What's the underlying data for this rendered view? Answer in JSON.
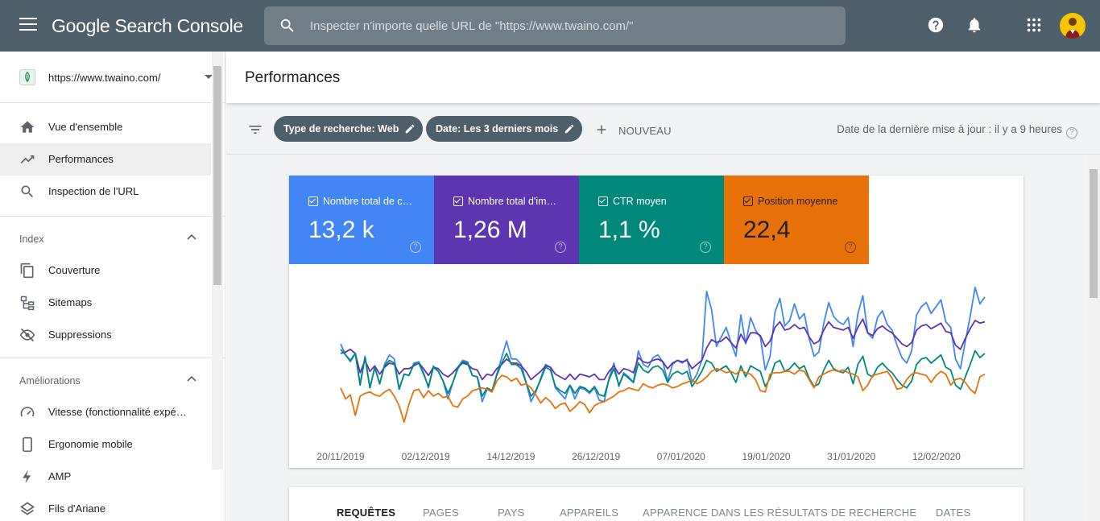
{
  "app": {
    "brand": "Google Search Console",
    "search_placeholder": "Inspecter n'importe quelle URL de \"https://www.twaino.com/\""
  },
  "sidebar": {
    "property_url": "https://www.twaino.com/",
    "top_items": [
      {
        "label": "Vue d'ensemble",
        "icon": "home-icon"
      },
      {
        "label": "Performances",
        "icon": "trending-up-icon",
        "active": true
      },
      {
        "label": "Inspection de l'URL",
        "icon": "search-icon"
      }
    ],
    "sections": [
      {
        "title": "Index",
        "items": [
          {
            "label": "Couverture",
            "icon": "copy-icon"
          },
          {
            "label": "Sitemaps",
            "icon": "sitemap-icon"
          },
          {
            "label": "Suppressions",
            "icon": "visibility-off-icon"
          }
        ]
      },
      {
        "title": "Améliorations",
        "items": [
          {
            "label": "Vitesse (fonctionnalité expé…",
            "icon": "speed-icon"
          },
          {
            "label": "Ergonomie mobile",
            "icon": "smartphone-icon"
          },
          {
            "label": "AMP",
            "icon": "bolt-icon"
          },
          {
            "label": "Fils d'Ariane",
            "icon": "layers-icon"
          }
        ]
      }
    ]
  },
  "main": {
    "page_title": "Performances",
    "filters": {
      "chips": [
        "Type de recherche: Web",
        "Date: Les 3 derniers mois"
      ],
      "new_label": "NOUVEAU",
      "updated": "Date de la dernière mise à jour : il y a 9 heures"
    },
    "metrics": [
      {
        "label": "Nombre total de c…",
        "value": "13,2 k",
        "color": "#4285f4",
        "text_color": "#ffffff"
      },
      {
        "label": "Nombre total d'im…",
        "value": "1,26 M",
        "color": "#5e35b1",
        "text_color": "#ffffff"
      },
      {
        "label": "CTR moyen",
        "value": "1,1 %",
        "color": "#00897b",
        "text_color": "#ffffff"
      },
      {
        "label": "Position moyenne",
        "value": "22,4",
        "color": "#e8710a",
        "text_color": "#202124"
      }
    ],
    "tabs": [
      "REQUÊTES",
      "PAGES",
      "PAYS",
      "APPAREILS",
      "APPARENCE DANS LES RÉSULTATS DE RECHERCHE",
      "DATES"
    ]
  },
  "chart_data": {
    "type": "line",
    "x_ticks": [
      "20/11/2019",
      "02/12/2019",
      "14/12/2019",
      "26/12/2019",
      "07/01/2020",
      "19/01/2020",
      "31/01/2020",
      "12/02/2020"
    ],
    "y_axis": "hidden (relative scale per series)",
    "grid": false,
    "series": [
      {
        "name": "Nombre total de c…",
        "color": "#4285f4",
        "values": [
          0.62,
          0.54,
          0.49,
          0.55,
          0.33,
          0.53,
          0.3,
          0.45,
          0.33,
          0.47,
          0.54,
          0.51,
          0.29,
          0.4,
          0.39,
          0.48,
          0.49,
          0.41,
          0.3,
          0.46,
          0.42,
          0.35,
          0.22,
          0.34,
          0.45,
          0.5,
          0.49,
          0.39,
          0.38,
          0.2,
          0.29,
          0.27,
          0.4,
          0.52,
          0.64,
          0.51,
          0.51,
          0.47,
          0.34,
          0.2,
          0.27,
          0.37,
          0.47,
          0.45,
          0.3,
          0.26,
          0.22,
          0.32,
          0.22,
          0.3,
          0.29,
          0.26,
          0.3,
          0.21,
          0.2,
          0.37,
          0.48,
          0.31,
          0.41,
          0.38,
          0.34,
          0.57,
          0.47,
          0.45,
          0.52,
          0.54,
          0.49,
          0.35,
          0.47,
          0.5,
          0.48,
          0.51,
          0.34,
          0.4,
          0.5,
          1.0,
          0.87,
          0.6,
          0.67,
          0.74,
          0.63,
          0.53,
          0.83,
          0.62,
          0.81,
          0.72,
          0.67,
          0.43,
          0.53,
          0.85,
          0.95,
          0.75,
          0.79,
          0.91,
          0.8,
          0.84,
          0.66,
          0.53,
          0.56,
          0.77,
          0.92,
          0.82,
          0.78,
          0.76,
          0.81,
          0.6,
          0.84,
          0.97,
          0.7,
          0.66,
          0.81,
          0.86,
          0.76,
          0.72,
          0.61,
          0.52,
          0.48,
          0.57,
          0.83,
          0.89,
          0.92,
          0.84,
          0.89,
          0.94,
          0.78,
          0.74,
          0.51,
          0.44,
          0.64,
          0.82,
          1.03,
          0.91,
          0.96
        ]
      },
      {
        "name": "Nombre total d'im…",
        "color": "#5e35b1",
        "values": [
          0.55,
          0.56,
          0.58,
          0.55,
          0.41,
          0.5,
          0.42,
          0.46,
          0.4,
          0.45,
          0.48,
          0.47,
          0.4,
          0.44,
          0.44,
          0.46,
          0.48,
          0.44,
          0.39,
          0.45,
          0.44,
          0.4,
          0.38,
          0.41,
          0.45,
          0.48,
          0.47,
          0.44,
          0.43,
          0.36,
          0.4,
          0.39,
          0.44,
          0.47,
          0.51,
          0.48,
          0.48,
          0.46,
          0.42,
          0.36,
          0.39,
          0.42,
          0.46,
          0.45,
          0.4,
          0.38,
          0.36,
          0.4,
          0.36,
          0.4,
          0.39,
          0.38,
          0.4,
          0.36,
          0.36,
          0.42,
          0.46,
          0.4,
          0.44,
          0.43,
          0.41,
          0.52,
          0.49,
          0.48,
          0.5,
          0.51,
          0.49,
          0.44,
          0.48,
          0.5,
          0.49,
          0.5,
          0.44,
          0.47,
          0.5,
          0.59,
          0.65,
          0.63,
          0.64,
          0.67,
          0.63,
          0.59,
          0.69,
          0.63,
          0.7,
          0.7,
          0.68,
          0.6,
          0.64,
          0.74,
          0.78,
          0.72,
          0.73,
          0.76,
          0.73,
          0.74,
          0.67,
          0.62,
          0.64,
          0.72,
          0.78,
          0.74,
          0.73,
          0.72,
          0.74,
          0.66,
          0.74,
          0.8,
          0.7,
          0.68,
          0.73,
          0.75,
          0.72,
          0.7,
          0.66,
          0.62,
          0.6,
          0.63,
          0.72,
          0.75,
          0.76,
          0.73,
          0.75,
          0.77,
          0.71,
          0.7,
          0.61,
          0.58,
          0.66,
          0.73,
          0.79,
          0.77,
          0.78
        ]
      },
      {
        "name": "CTR moyen",
        "color": "#00897b",
        "values": [
          0.58,
          0.54,
          0.5,
          0.55,
          0.32,
          0.52,
          0.3,
          0.45,
          0.33,
          0.46,
          0.5,
          0.48,
          0.29,
          0.4,
          0.39,
          0.47,
          0.48,
          0.4,
          0.31,
          0.45,
          0.42,
          0.35,
          0.26,
          0.34,
          0.44,
          0.49,
          0.48,
          0.39,
          0.38,
          0.24,
          0.3,
          0.28,
          0.39,
          0.48,
          0.55,
          0.47,
          0.47,
          0.44,
          0.34,
          0.24,
          0.28,
          0.36,
          0.45,
          0.43,
          0.31,
          0.28,
          0.26,
          0.32,
          0.26,
          0.31,
          0.3,
          0.27,
          0.31,
          0.25,
          0.24,
          0.36,
          0.44,
          0.32,
          0.4,
          0.37,
          0.34,
          0.48,
          0.43,
          0.41,
          0.45,
          0.46,
          0.43,
          0.34,
          0.4,
          0.42,
          0.4,
          0.42,
          0.31,
          0.36,
          0.42,
          0.5,
          0.48,
          0.42,
          0.44,
          0.46,
          0.41,
          0.34,
          0.46,
          0.38,
          0.46,
          0.44,
          0.42,
          0.31,
          0.37,
          0.48,
          0.5,
          0.42,
          0.44,
          0.48,
          0.44,
          0.46,
          0.37,
          0.31,
          0.33,
          0.43,
          0.5,
          0.44,
          0.42,
          0.41,
          0.45,
          0.33,
          0.47,
          0.53,
          0.4,
          0.38,
          0.45,
          0.48,
          0.44,
          0.41,
          0.36,
          0.32,
          0.3,
          0.35,
          0.47,
          0.51,
          0.52,
          0.48,
          0.51,
          0.54,
          0.45,
          0.43,
          0.32,
          0.29,
          0.38,
          0.47,
          0.57,
          0.52,
          0.55
        ]
      },
      {
        "name": "Position moyenne",
        "color": "#e8710a",
        "values": [
          0.3,
          0.22,
          0.25,
          0.1,
          0.24,
          0.26,
          0.27,
          0.25,
          0.24,
          0.27,
          0.29,
          0.24,
          0.17,
          0.05,
          0.18,
          0.28,
          0.29,
          0.23,
          0.28,
          0.24,
          0.26,
          0.23,
          0.24,
          0.17,
          0.16,
          0.22,
          0.24,
          0.28,
          0.29,
          0.3,
          0.29,
          0.27,
          0.35,
          0.39,
          0.38,
          0.35,
          0.37,
          0.32,
          0.33,
          0.3,
          0.25,
          0.19,
          0.23,
          0.2,
          0.15,
          0.18,
          0.19,
          0.13,
          0.16,
          0.2,
          0.18,
          0.12,
          0.17,
          0.19,
          0.2,
          0.22,
          0.24,
          0.27,
          0.28,
          0.3,
          0.29,
          0.28,
          0.33,
          0.31,
          0.3,
          0.32,
          0.33,
          0.32,
          0.3,
          0.31,
          0.33,
          0.34,
          0.36,
          0.33,
          0.35,
          0.38,
          0.42,
          0.44,
          0.43,
          0.41,
          0.42,
          0.4,
          0.43,
          0.41,
          0.4,
          0.36,
          0.28,
          0.27,
          0.4,
          0.41,
          0.41,
          0.42,
          0.42,
          0.4,
          0.43,
          0.42,
          0.36,
          0.3,
          0.38,
          0.4,
          0.42,
          0.43,
          0.42,
          0.43,
          0.41,
          0.4,
          0.38,
          0.28,
          0.32,
          0.39,
          0.4,
          0.41,
          0.42,
          0.37,
          0.29,
          0.3,
          0.36,
          0.4,
          0.41,
          0.4,
          0.39,
          0.34,
          0.39,
          0.42,
          0.4,
          0.32,
          0.36,
          0.37,
          0.34,
          0.29,
          0.26,
          0.38,
          0.4
        ]
      }
    ]
  }
}
